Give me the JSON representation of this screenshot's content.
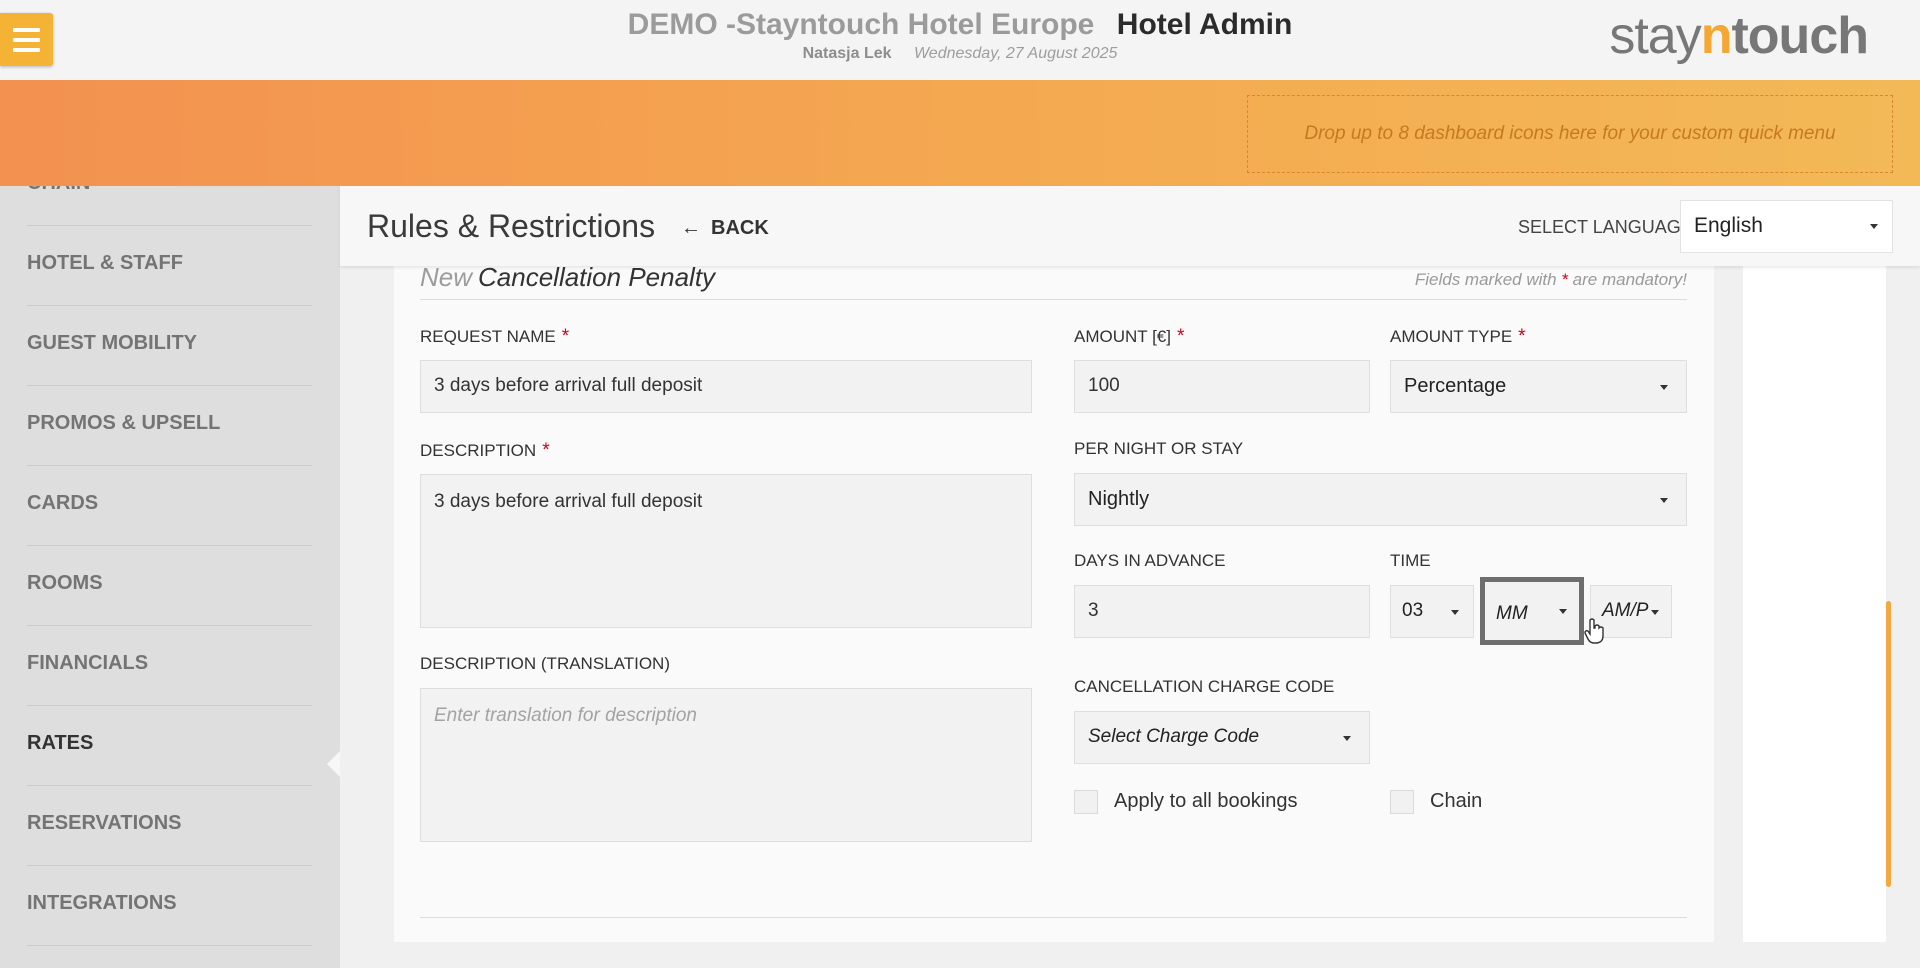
{
  "header": {
    "hotel_name": "DEMO -Stayntouch Hotel Europe",
    "app_name": "Hotel Admin",
    "user_name": "Natasja Lek",
    "date": "Wednesday, 27 August 2025",
    "logo_pre": "stay",
    "logo_n": "n",
    "logo_post": "touch"
  },
  "quick_menu": {
    "placeholder": "Drop up to 8 dashboard icons here for your custom quick menu"
  },
  "sidebar": {
    "items": [
      {
        "label": "CHAIN"
      },
      {
        "label": "HOTEL & STAFF"
      },
      {
        "label": "GUEST MOBILITY"
      },
      {
        "label": "PROMOS & UPSELL"
      },
      {
        "label": "CARDS"
      },
      {
        "label": "ROOMS"
      },
      {
        "label": "FINANCIALS"
      },
      {
        "label": "RATES",
        "active": true
      },
      {
        "label": "RESERVATIONS"
      },
      {
        "label": "INTEGRATIONS"
      }
    ]
  },
  "page": {
    "title": "Rules & Restrictions",
    "back_label": "BACK",
    "language_label": "SELECT LANGUAGE",
    "language_value": "English"
  },
  "form": {
    "new_word": "New",
    "title": "Cancellation Penalty",
    "mandatory_pre": "Fields marked with",
    "mandatory_star": "*",
    "mandatory_post": "are mandatory!",
    "request_name_label": "REQUEST NAME",
    "request_name_value": "3 days before arrival full deposit",
    "description_label": "DESCRIPTION",
    "description_value": "3 days before arrival full deposit",
    "translation_label": "DESCRIPTION (TRANSLATION)",
    "translation_placeholder": "Enter translation for description",
    "amount_label": "AMOUNT [€]",
    "amount_value": "100",
    "amount_type_label": "AMOUNT TYPE",
    "amount_type_value": "Percentage",
    "per_night_label": "PER NIGHT OR STAY",
    "per_night_value": "Nightly",
    "days_label": "DAYS IN ADVANCE",
    "days_value": "3",
    "time_label": "TIME",
    "time_hh": "03",
    "time_mm": "MM",
    "time_ampm": "AM/P",
    "charge_code_label": "CANCELLATION CHARGE CODE",
    "charge_code_placeholder": "Select Charge Code",
    "apply_all_label": "Apply to all bookings",
    "chain_label": "Chain",
    "required_star": "*"
  },
  "colors": {
    "accent": "#f5b335",
    "band_start": "#f39150",
    "band_end": "#f3b957",
    "required": "#d0021b"
  }
}
